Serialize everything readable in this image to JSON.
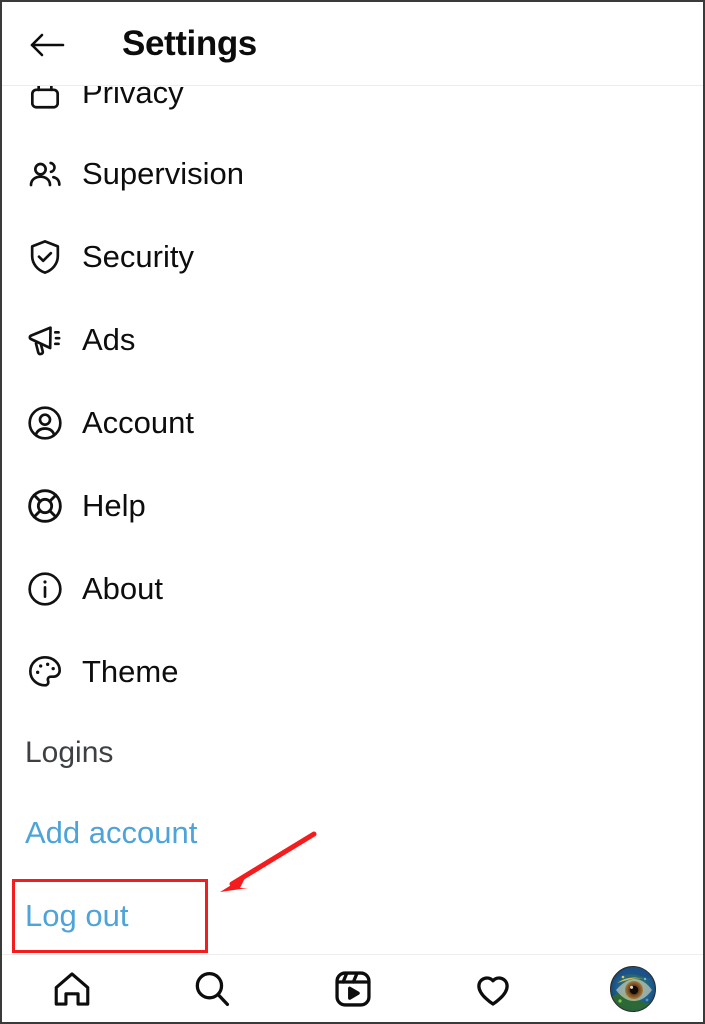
{
  "header": {
    "title": "Settings",
    "back_icon": "arrow-left-icon"
  },
  "menu": {
    "items": [
      {
        "label": "Privacy",
        "icon": "lock-icon",
        "clipped": true
      },
      {
        "label": "Supervision",
        "icon": "people-icon"
      },
      {
        "label": "Security",
        "icon": "shield-check-icon"
      },
      {
        "label": "Ads",
        "icon": "megaphone-icon"
      },
      {
        "label": "Account",
        "icon": "person-circle-icon"
      },
      {
        "label": "Help",
        "icon": "life-ring-icon"
      },
      {
        "label": "About",
        "icon": "info-circle-icon"
      },
      {
        "label": "Theme",
        "icon": "palette-icon"
      }
    ]
  },
  "logins": {
    "section_label": "Logins",
    "add_account_label": "Add account",
    "log_out_label": "Log out",
    "link_color": "#4ea3d8"
  },
  "annotation": {
    "highlight_target": "Log out",
    "box_color": "#f41c1c",
    "arrow_color": "#f41c1c"
  },
  "bottom_nav": {
    "items": [
      {
        "name": "home",
        "icon": "home-icon"
      },
      {
        "name": "search",
        "icon": "search-icon"
      },
      {
        "name": "reels",
        "icon": "reels-icon"
      },
      {
        "name": "activity",
        "icon": "heart-icon"
      },
      {
        "name": "profile",
        "icon": "avatar-eye-image"
      }
    ]
  }
}
